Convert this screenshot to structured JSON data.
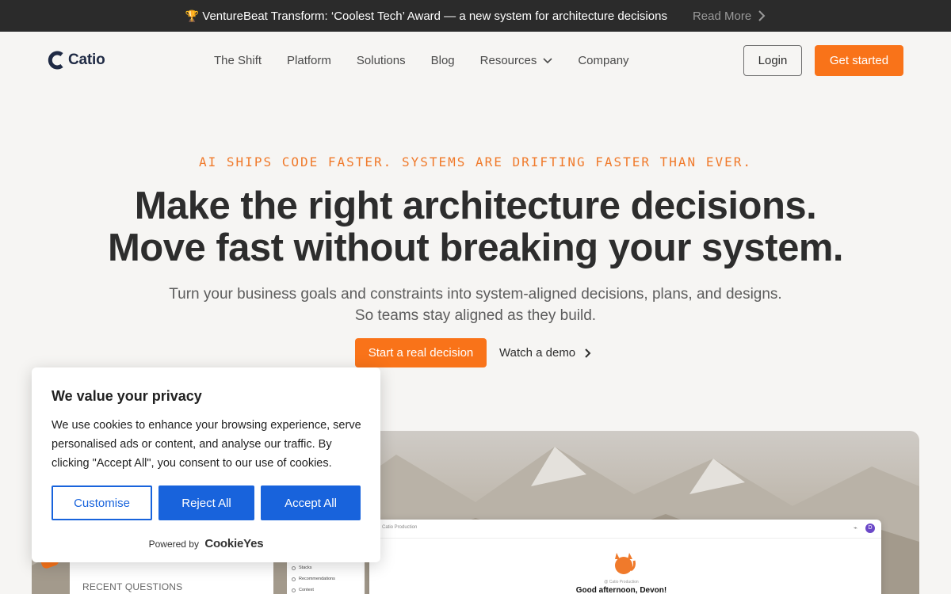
{
  "banner": {
    "trophy_icon": "trophy-icon",
    "text": "VentureBeat Transform: ‘Coolest Tech’ Award — a new system for architecture decisions",
    "read_more": "Read More"
  },
  "nav": {
    "brand": "Catio",
    "items": [
      {
        "label": "The Shift"
      },
      {
        "label": "Platform"
      },
      {
        "label": "Solutions"
      },
      {
        "label": "Blog"
      },
      {
        "label": "Resources"
      },
      {
        "label": "Company"
      }
    ],
    "login": "Login",
    "get_started": "Get started"
  },
  "hero": {
    "eyebrow": "AI SHIPS CODE FASTER. SYSTEMS ARE DRIFTING FASTER THAN EVER.",
    "headline_line1": "Make the right architecture decisions.",
    "headline_line2": "Move fast without breaking your system.",
    "sub_line1": "Turn your business goals and constraints into system-aligned decisions, plans, and designs.",
    "sub_line2": "So teams stay aligned as they build.",
    "cta": "Start a real decision",
    "demo": "Watch a demo"
  },
  "app_preview": {
    "title": "Catio Production",
    "avatar": "D",
    "org": "@ Catio Production",
    "greeting": "Good afternoon, Devon!",
    "side_items": [
      "Stacks",
      "Recommendations",
      "Context"
    ],
    "recent_questions": "RECENT QUESTIONS"
  },
  "cookie": {
    "title": "We value your privacy",
    "body": "We use cookies to enhance your browsing experience, serve personalised ads or content, and analyse our traffic. By clicking \"Accept All\", you consent to our use of cookies.",
    "customise": "Customise",
    "reject": "Reject All",
    "accept": "Accept All",
    "powered_by": "Powered by",
    "powered_brand": "CookieYes"
  },
  "colors": {
    "accent": "#f97319",
    "cookie_blue": "#1863dc",
    "banner_bg": "#2b2b2b",
    "page_bg": "#f6f5f3"
  }
}
